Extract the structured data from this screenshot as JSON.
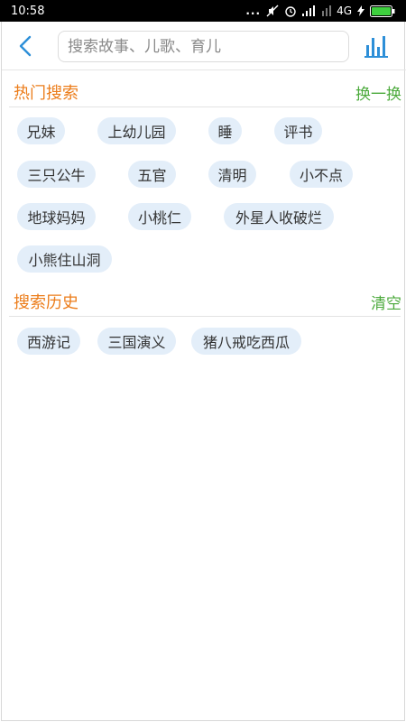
{
  "status_bar": {
    "time": "10:58",
    "dots": "...",
    "network": "4G",
    "icons": [
      "mute-icon",
      "alarm-icon",
      "signal-icon",
      "signal-4g-icon",
      "charging-icon",
      "battery-icon"
    ]
  },
  "header": {
    "back_icon": "chevron-left-icon",
    "search_placeholder": "搜索故事、儿歌、育儿",
    "chart_icon": "bar-chart-icon"
  },
  "hot_search": {
    "title": "热门搜索",
    "action": "换一换",
    "tags": [
      "兄妹",
      "上幼儿园",
      "睡",
      "评书",
      "三只公牛",
      "五官",
      "清明",
      "小不点",
      "地球妈妈",
      "小桃仁",
      "外星人收破烂",
      "小熊住山洞"
    ]
  },
  "history": {
    "title": "搜索历史",
    "action": "清空",
    "tags": [
      "西游记",
      "三国演义",
      "猪八戒吃西瓜"
    ]
  },
  "colors": {
    "accent_orange": "#ec7d1b",
    "action_green": "#4caa3c",
    "icon_blue": "#2d8fd8",
    "tag_bg": "#e3eef9"
  }
}
